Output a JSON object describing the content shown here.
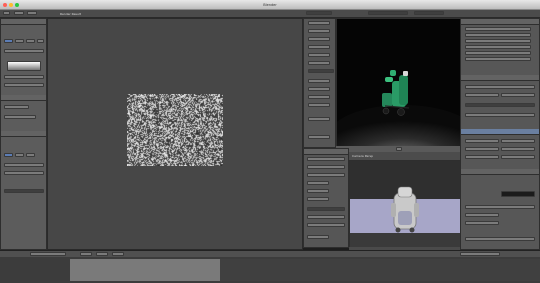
{
  "window": {
    "title": "Blender",
    "close_color": "#ff5f57",
    "minimize_color": "#febc2e",
    "zoom_color": "#28c840"
  },
  "image_editor": {
    "header_text": "Render Result"
  },
  "preview_panel": {
    "header_text": "Camera Persp"
  }
}
